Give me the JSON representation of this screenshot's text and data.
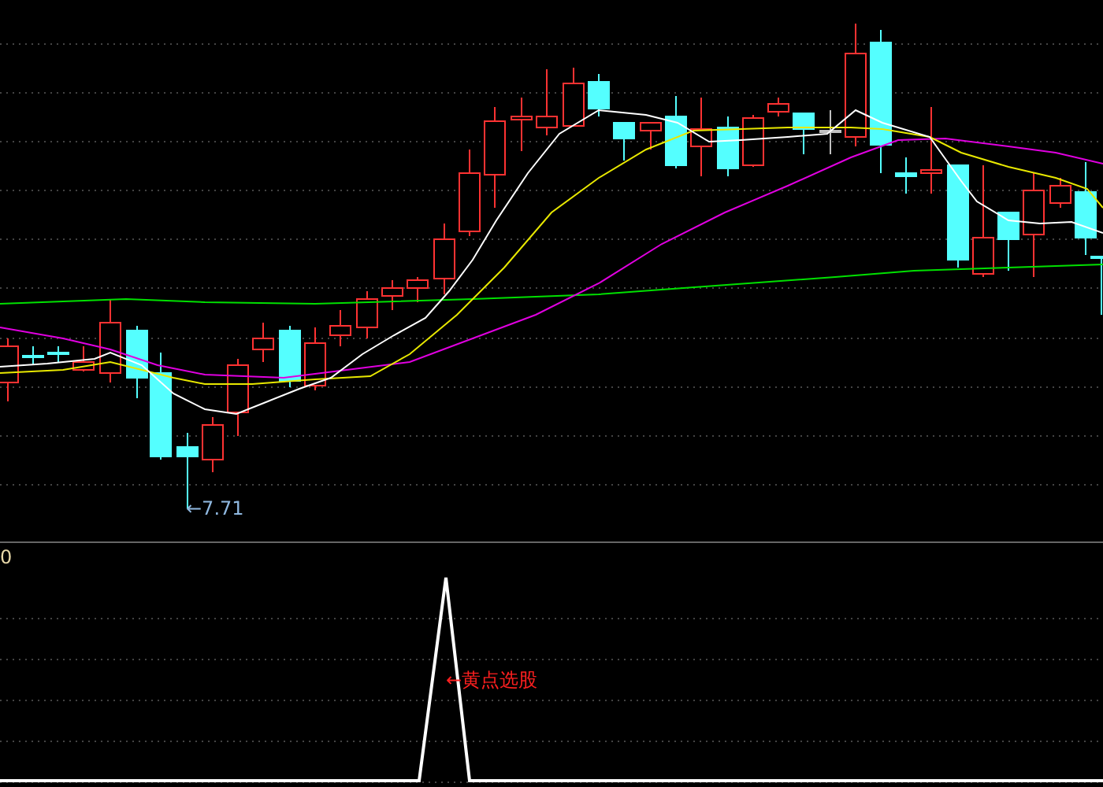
{
  "price_panel": {
    "low_label": "←7.71"
  },
  "indicator_panel": {
    "axis_label": "0",
    "signal_label": "←黄点选股"
  }
}
